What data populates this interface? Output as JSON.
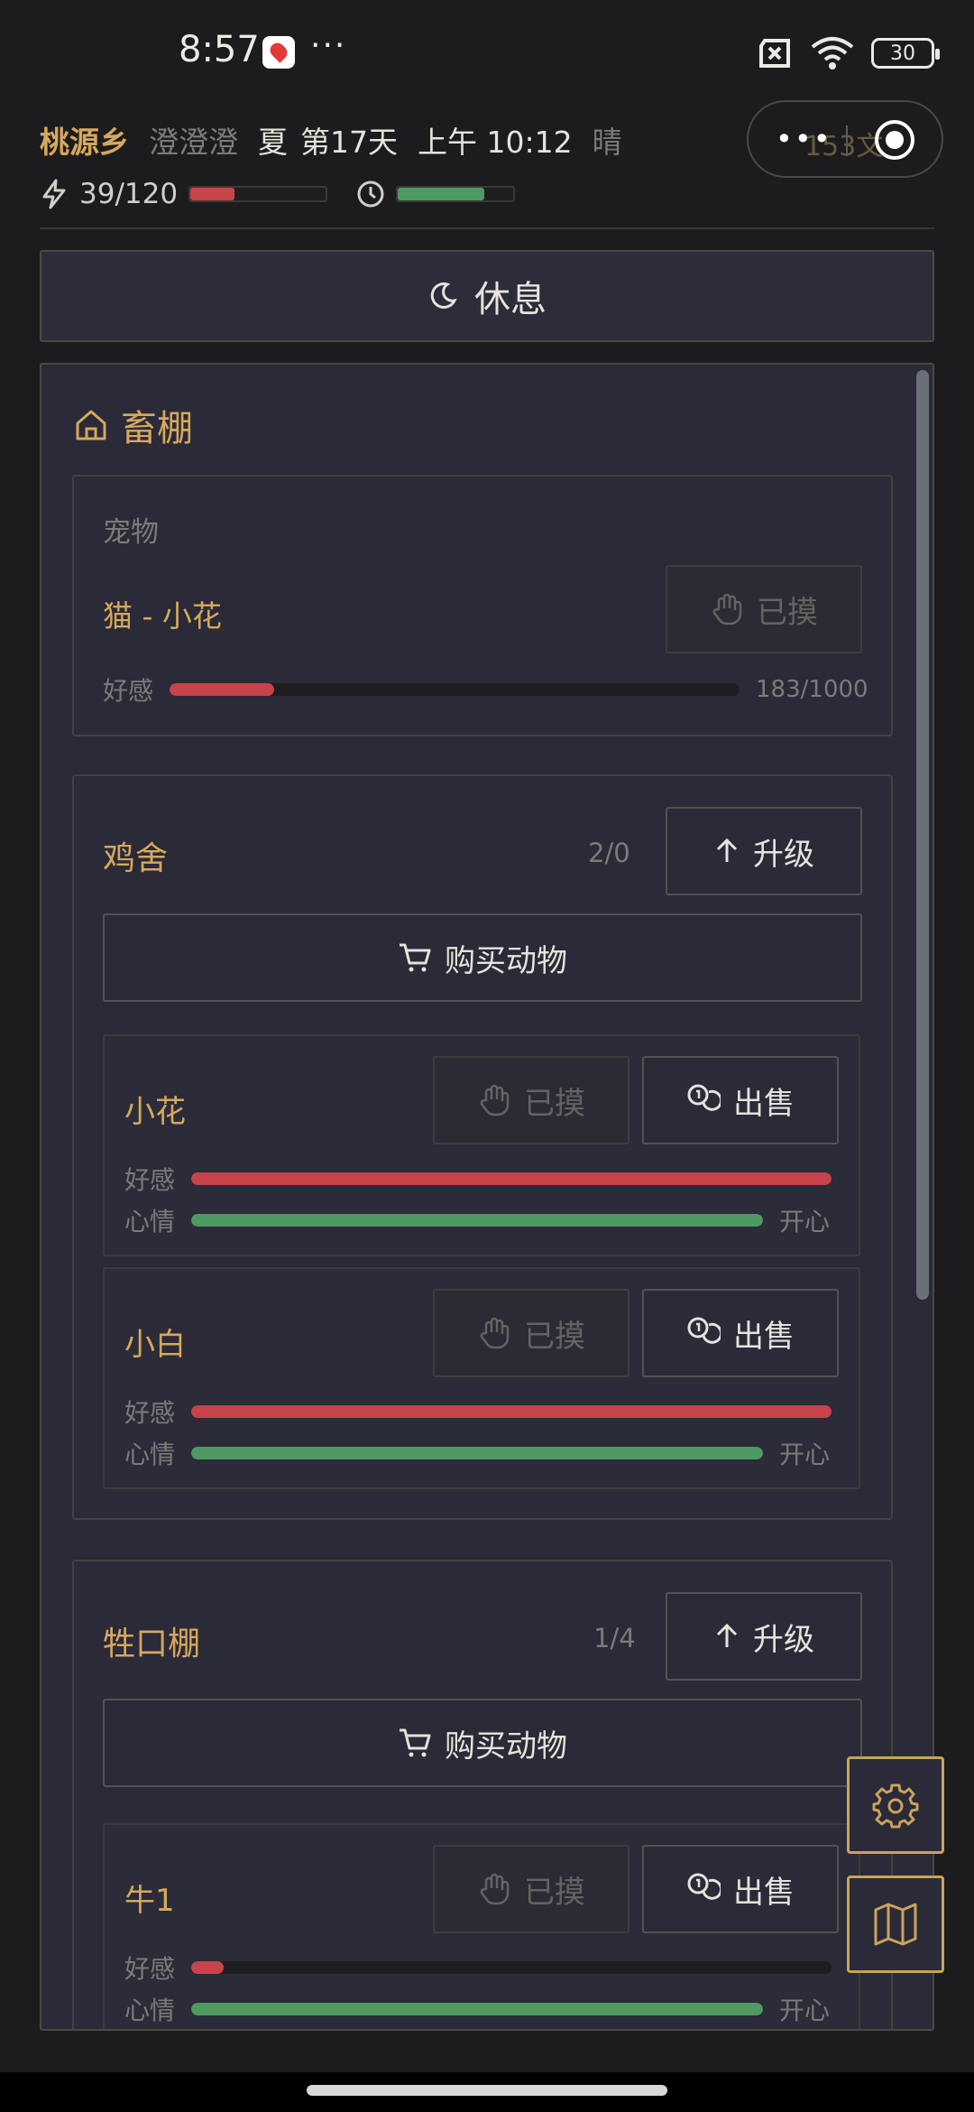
{
  "status_bar": {
    "time": "8:57",
    "dots": "···",
    "battery": "30"
  },
  "header": {
    "village": "桃源乡",
    "player": "澄澄澄",
    "season": "夏",
    "day": "第17天",
    "time": "上午 10:12",
    "weather": "晴",
    "money": "153文",
    "stamina": "39/120",
    "stamina_fraction": 0.325,
    "time_fraction": 0.75
  },
  "rest_button": {
    "label": "休息"
  },
  "panel": {
    "title": "畜棚",
    "pet": {
      "section_label": "宠物",
      "name": "猫 - 小花",
      "pet_button": "已摸",
      "affection_label": "好感",
      "affection_value": "183/1000",
      "affection_fraction": 0.183
    },
    "coop": {
      "title": "鸡舍",
      "count": "2/0",
      "upgrade_label": "升级",
      "buy_label": "购买动物",
      "animals": [
        {
          "name": "小花",
          "pet_label": "已摸",
          "sell_label": "出售",
          "affection_label": "好感",
          "affection_fraction": 1.0,
          "mood_label": "心情",
          "mood_fraction": 1.0,
          "mood_text": "开心"
        },
        {
          "name": "小白",
          "pet_label": "已摸",
          "sell_label": "出售",
          "affection_label": "好感",
          "affection_fraction": 1.0,
          "mood_label": "心情",
          "mood_fraction": 1.0,
          "mood_text": "开心"
        }
      ]
    },
    "barn": {
      "title": "牲口棚",
      "count": "1/4",
      "upgrade_label": "升级",
      "buy_label": "购买动物",
      "animals": [
        {
          "name": "牛1",
          "pet_label": "已摸",
          "sell_label": "出售",
          "affection_label": "好感",
          "affection_fraction": 0.05,
          "mood_label": "心情",
          "mood_fraction": 1.0,
          "mood_text": "开心"
        }
      ]
    }
  },
  "fabs": {
    "settings": "gear-icon",
    "map": "map-icon"
  },
  "colors": {
    "gold": "#d6a85c",
    "red": "#c7444a",
    "green": "#4f9a62",
    "panel": "#2a2a38"
  }
}
